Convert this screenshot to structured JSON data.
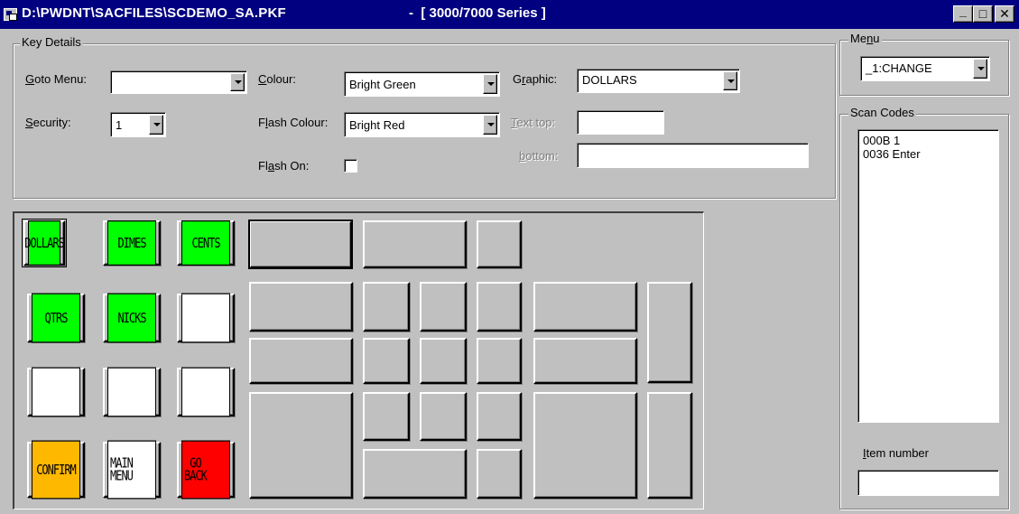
{
  "window": {
    "title": "D:\\PWDNT\\SACFILES\\SCDEMO_SA.PKF",
    "series": "-  [ 3000/7000 Series ]",
    "minimize": "_",
    "maximize": "□",
    "close": "✕"
  },
  "key_details": {
    "legend": "Key Details",
    "goto_menu": {
      "label_pre": "",
      "label_u": "G",
      "label_post": "oto Menu:",
      "value": ""
    },
    "security": {
      "label_pre": "",
      "label_u": "S",
      "label_post": "ecurity:",
      "value": "1"
    },
    "colour": {
      "label_pre": "",
      "label_u": "C",
      "label_post": "olour:",
      "value": "Bright Green"
    },
    "flash_colour": {
      "label_pre": "F",
      "label_u": "l",
      "label_post": "ash Colour:",
      "value": "Bright Red"
    },
    "flash_on": {
      "label_pre": "Fl",
      "label_u": "a",
      "label_post": "sh On:",
      "checked": false
    },
    "graphic": {
      "label_pre": "G",
      "label_u": "r",
      "label_post": "aphic:",
      "value": "DOLLARS"
    },
    "text_top": {
      "label_pre": "",
      "label_u": "T",
      "label_post": "ext top:",
      "value": ""
    },
    "text_bottom": {
      "label_pre": "",
      "label_u": "b",
      "label_post": "ottom:",
      "value": ""
    }
  },
  "menu": {
    "legend_pre": "Me",
    "legend_u": "n",
    "legend_post": "u",
    "value": "_1:CHANGE"
  },
  "scan_codes": {
    "legend": "Scan Codes",
    "items": [
      "000B 1",
      "0036 Enter"
    ]
  },
  "item_number": {
    "label_pre": "",
    "label_u": "I",
    "label_post": "tem number",
    "value": ""
  },
  "keys": {
    "dollars": "DOLLARS",
    "dimes": "DIMES",
    "cents": "CENTS",
    "qtrs": "QTRS",
    "nicks": "NICKS",
    "confirm": "CONFIRM",
    "main_menu": "MAIN\nMENU",
    "go_back": "GO\nBACK"
  },
  "colors": {
    "green": "#00ff00",
    "white": "#ffffff",
    "amber": "#ffb800",
    "red": "#ff0000",
    "titlebar": "#000080"
  }
}
